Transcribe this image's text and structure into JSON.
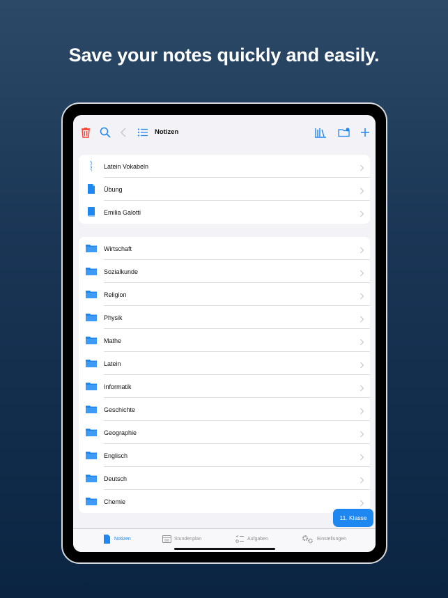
{
  "headline": "Save your notes quickly and easily.",
  "toolbar": {
    "title": "Notizen",
    "icons": [
      "trash-icon",
      "search-icon",
      "back-chevron-icon",
      "list-icon",
      "library-icon",
      "new-folder-icon",
      "plus-icon"
    ]
  },
  "notes_group": [
    {
      "label": "Latein Vokabeln",
      "icon": "vocab-icon"
    },
    {
      "label": "Übung",
      "icon": "document-icon"
    },
    {
      "label": "Emilia Galotti",
      "icon": "book-icon"
    }
  ],
  "folders": [
    {
      "label": "Wirtschaft"
    },
    {
      "label": "Sozialkunde"
    },
    {
      "label": "Religion"
    },
    {
      "label": "Physik"
    },
    {
      "label": "Mathe"
    },
    {
      "label": "Latein"
    },
    {
      "label": "Informatik"
    },
    {
      "label": "Geschichte"
    },
    {
      "label": "Geographie"
    },
    {
      "label": "Englisch"
    },
    {
      "label": "Deutsch"
    },
    {
      "label": "Chemie"
    }
  ],
  "class_button": "11. Klasse",
  "tabs": [
    {
      "label": "Notizen",
      "icon": "note-icon",
      "active": true
    },
    {
      "label": "Stundenplan",
      "icon": "calendar-icon",
      "active": false
    },
    {
      "label": "Aufgaben",
      "icon": "checklist-icon",
      "active": false
    },
    {
      "label": "Einstellungen",
      "icon": "gears-icon",
      "active": false
    }
  ],
  "colors": {
    "accent": "#1e87f0",
    "danger": "#ff3b30",
    "background_top": "#2c4a68",
    "background_bottom": "#0a2442"
  }
}
